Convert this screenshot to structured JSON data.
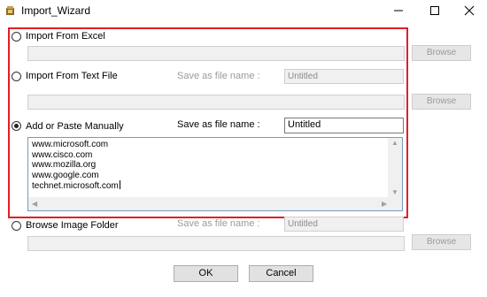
{
  "window": {
    "title": "Import_Wizard",
    "controls": {
      "minimize": "minimize-icon",
      "maximize": "maximize-icon",
      "close": "close-icon"
    }
  },
  "options": {
    "excel": {
      "label": "Import From Excel",
      "selected": false,
      "browse_label": "Browse"
    },
    "textfile": {
      "label": "Import From Text File",
      "selected": false,
      "save_label": "Save as file name :",
      "save_value": "Untitled",
      "browse_label": "Browse"
    },
    "manual": {
      "label": "Add or Paste Manually",
      "selected": true,
      "save_label": "Save as file name :",
      "save_value": "Untitled",
      "lines": [
        "www.microsoft.com",
        "www.cisco.com",
        "www.mozilla.org",
        "www.google.com",
        "technet.microsoft.com"
      ]
    },
    "imagefolder": {
      "label": "Browse Image Folder",
      "selected": false,
      "save_label": "Save as file name :",
      "save_value": "Untitled",
      "browse_label": "Browse"
    }
  },
  "footer": {
    "ok_label": "OK",
    "cancel_label": "Cancel"
  },
  "colors": {
    "highlight_border": "#e11f26"
  }
}
